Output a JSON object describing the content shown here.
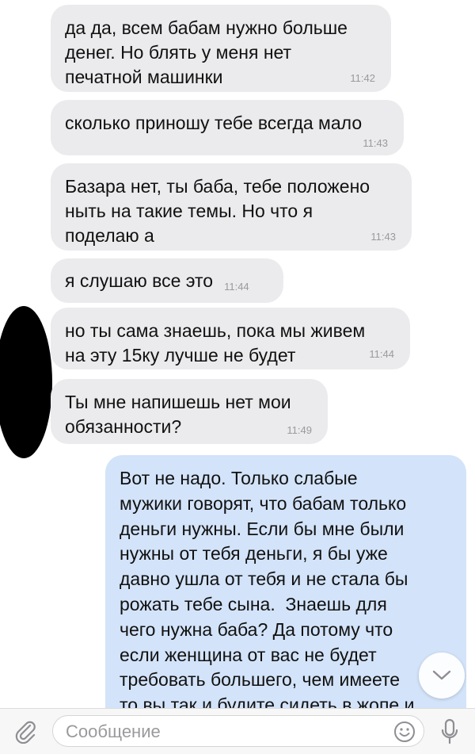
{
  "messages": [
    {
      "direction": "in",
      "text": "да да, всем бабам нужно больше\nденег. Но блять у меня нет\nпечатной машинки",
      "time": "11:42"
    },
    {
      "direction": "in",
      "text": "сколько приношу тебе всегда мало",
      "time": "11:43"
    },
    {
      "direction": "in",
      "text": "Базара нет, ты баба, тебе положено\nныть на такие темы. Но что я\nподелаю а",
      "time": "11:43"
    },
    {
      "direction": "in",
      "text": "я слушаю все это",
      "time": "11:44"
    },
    {
      "direction": "in",
      "text": "но ты сама знаешь, пока мы живем\nна эту 15ку лучше не будет",
      "time": "11:44"
    },
    {
      "direction": "in",
      "text": "Ты мне напишешь нет мои\nобязанности?",
      "time": "11:49"
    },
    {
      "direction": "out",
      "text": "Вот не надо. Только слабые\nмужики говорят, что бабам только\nденьги нужны. Если бы мне были\nнужны от тебя деньги, я бы уже\nдавно ушла от тебя и не стала бы\nрожать тебе сына.  Знаешь для\nчего нужна баба? Да потому что\nесли женщина от вас не будет\nтребовать большего, чем имеете\nто вы так и будите сидеть в жопе и"
    }
  ],
  "composer": {
    "placeholder": "Сообщение",
    "attach_icon": "paperclip-icon",
    "emoji_icon": "smiley-icon",
    "mic_icon": "microphone-icon"
  },
  "scroll_button_icon": "chevron-down-icon",
  "colors": {
    "incoming_bubble": "#ebebed",
    "outgoing_bubble": "#d3e3f9",
    "timestamp": "#9a9a9e",
    "icon": "#8e8e93"
  }
}
